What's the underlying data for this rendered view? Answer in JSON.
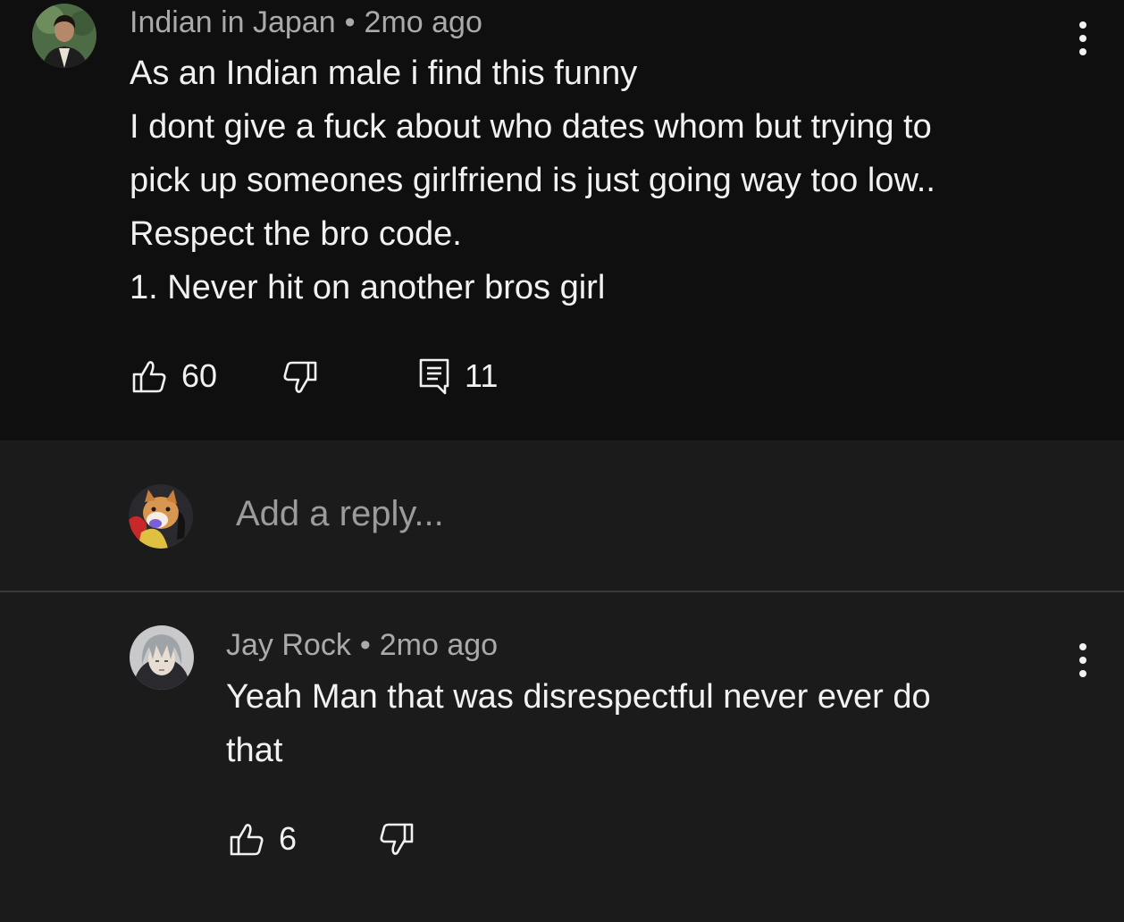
{
  "comment": {
    "author": "Indian in Japan",
    "separator": "•",
    "time": "2mo ago",
    "lines": [
      "As an Indian male i find this funny",
      "I dont give a fuck about who dates whom but trying to",
      "pick up someones girlfriend is just going way too low..",
      "Respect the bro code.",
      "1. Never hit on another bros girl"
    ],
    "likes": "60",
    "replies": "11",
    "icons": {
      "like": "thumbs-up-icon",
      "dislike": "thumbs-down-icon",
      "reply": "comment-icon",
      "more": "more-vertical-icon"
    }
  },
  "reply_box": {
    "placeholder": "Add a reply..."
  },
  "reply": {
    "author": "Jay Rock",
    "separator": "•",
    "time": "2mo ago",
    "lines": [
      "Yeah Man that was disrespectful never ever do",
      "that"
    ],
    "likes": "6"
  },
  "colors": {
    "background_top": "#0f0f0f",
    "background_bottom": "#1b1b1b",
    "text_primary": "#f1f1f1",
    "text_secondary": "#aaaaaa",
    "divider": "#3a3a3a"
  }
}
